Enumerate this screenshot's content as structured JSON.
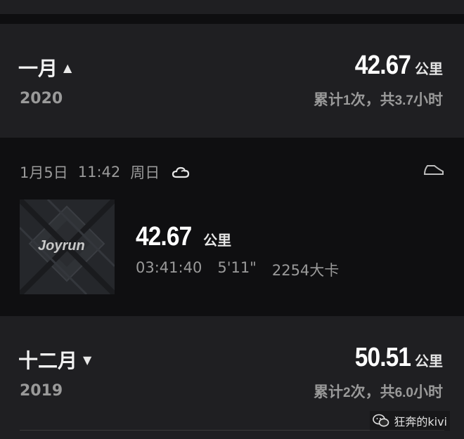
{
  "months": [
    {
      "name": "一月",
      "caret": "▲",
      "year": "2020",
      "distance": "42.67",
      "unit": "公里",
      "summary_prefix": "累计",
      "count": "1",
      "summary_mid": "次，共",
      "hours": "3.7",
      "summary_suffix": "小时"
    },
    {
      "name": "十二月",
      "caret": "▼",
      "year": "2019",
      "distance": "50.51",
      "unit": "公里",
      "summary_prefix": "累计",
      "count": "2",
      "summary_mid": "次，共",
      "hours": "6.0",
      "summary_suffix": "小时"
    }
  ],
  "run": {
    "date": "1月5日",
    "time": "11:42",
    "weekday": "周日",
    "weather_icon": "cloudy-icon",
    "shoe_icon": "shoe-icon",
    "thumbnail_label": "Joyrun",
    "distance": "42.67",
    "unit": "公里",
    "duration": "03:41:40",
    "pace": "5'11\"",
    "calories": "2254大卡"
  },
  "watermark": {
    "icon": "wechat-icon",
    "text": "狂奔的kivi"
  },
  "colors": {
    "header_bg": "#1f1f22",
    "run_bg": "#0f0f11",
    "primary_text": "#ffffff",
    "secondary_text": "#9a9a9a"
  }
}
